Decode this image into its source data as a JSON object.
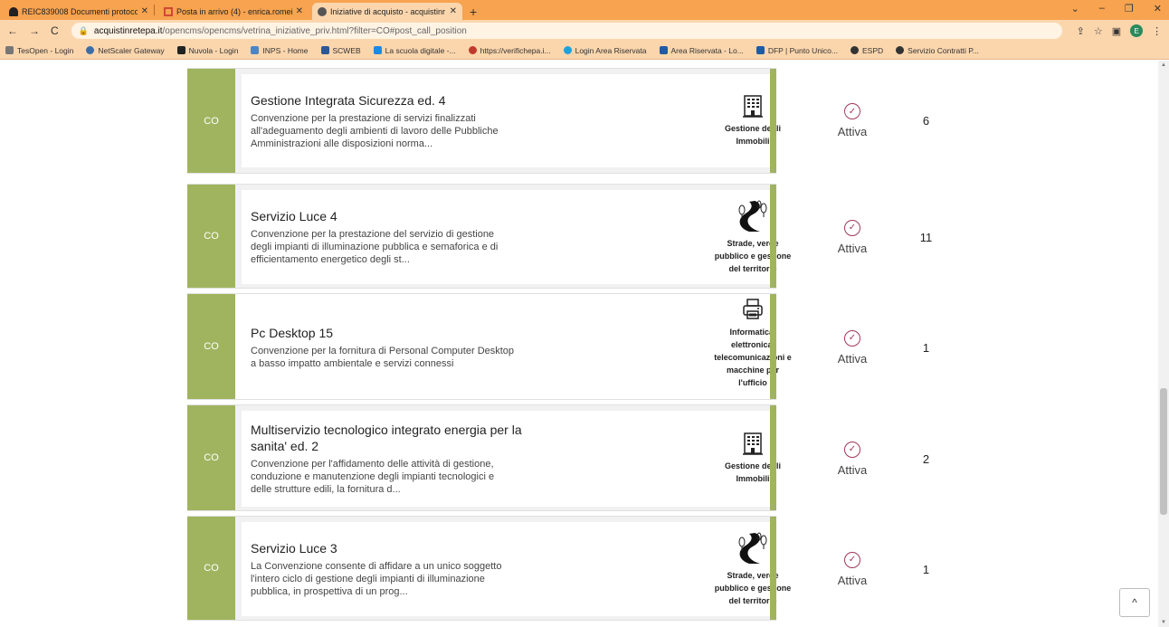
{
  "browser": {
    "tabs": [
      {
        "title": "REIC839008 Documenti protocol",
        "active": false
      },
      {
        "title": "Posta in arrivo (4) - enrica.romei",
        "active": false
      },
      {
        "title": "Iniziative di acquisto - acquistinr",
        "active": true
      }
    ],
    "new_tab": "+",
    "window_controls": [
      "⌄",
      "–",
      "❐",
      "✕"
    ],
    "url_host": "acquistinretepa.it",
    "url_path": "/opencms/opencms/vetrina_iniziative_priv.html?filter=CO#post_call_position",
    "profile_initial": "E",
    "bookmarks": [
      {
        "label": "TesOpen - Login",
        "color": "#777"
      },
      {
        "label": "NetScaler Gateway",
        "color": "#3b6ea8"
      },
      {
        "label": "Nuvola - Login",
        "color": "#222"
      },
      {
        "label": "INPS - Home",
        "color": "#4a86c5"
      },
      {
        "label": "SCWEB",
        "color": "#2b5797"
      },
      {
        "label": "La scuola digitale -...",
        "color": "#1e88e5"
      },
      {
        "label": "https://verifichepa.i...",
        "color": "#c0392b"
      },
      {
        "label": "Login Area Riservata",
        "color": "#1aa3e0"
      },
      {
        "label": "Area Riservata - Lo...",
        "color": "#1e5aa8"
      },
      {
        "label": "DFP | Punto Unico...",
        "color": "#1e5aa8"
      },
      {
        "label": "ESPD",
        "color": "#333"
      },
      {
        "label": "Servizio Contratti P...",
        "color": "#333"
      }
    ]
  },
  "cards": [
    {
      "tag": "CO",
      "title": "Gestione Integrata Sicurezza ed. 4",
      "description": "Convenzione per la prestazione di servizi finalizzati all'adeguamento degli ambienti di lavoro delle Pubbliche Amministrazioni alle disposizioni norma...",
      "category": "Gestione degli Immobili",
      "category_icon": "building-icon",
      "status": "Attiva",
      "count": "6"
    },
    {
      "tag": "CO",
      "title": "Servizio Luce 4",
      "description": "Convenzione per la prestazione del servizio di gestione degli impianti di illuminazione pubblica e semaforica e di efficientamento energetico degli st...",
      "category": "Strade, verde pubblico e gestione del territorio",
      "category_icon": "road-icon",
      "status": "Attiva",
      "count": "11"
    },
    {
      "tag": "CO",
      "title": "Pc Desktop 15",
      "description": "Convenzione per la fornitura di Personal Computer Desktop a basso impatto ambientale e servizi connessi",
      "category": "Informatica, elettronica, telecomunicazioni e macchine per l'ufficio",
      "category_icon": "printer-icon",
      "status": "Attiva",
      "count": "1"
    },
    {
      "tag": "CO",
      "title": "Multiservizio tecnologico integrato energia per la sanita' ed. 2",
      "description": "Convenzione per l'affidamento delle attività di gestione, conduzione e manutenzione degli impianti tecnologici e delle strutture edili, la fornitura d...",
      "category": "Gestione degli Immobili",
      "category_icon": "building-icon",
      "status": "Attiva",
      "count": "2"
    },
    {
      "tag": "CO",
      "title": "Servizio Luce 3",
      "description": "La Convenzione consente di affidare a un unico soggetto l'intero ciclo di gestione degli impianti di illuminazione pubblica, in prospettiva di un prog...",
      "category": "Strade, verde pubblico e gestione del territorio",
      "category_icon": "road-icon",
      "status": "Attiva",
      "count": "1"
    }
  ],
  "back_to_top": "^"
}
